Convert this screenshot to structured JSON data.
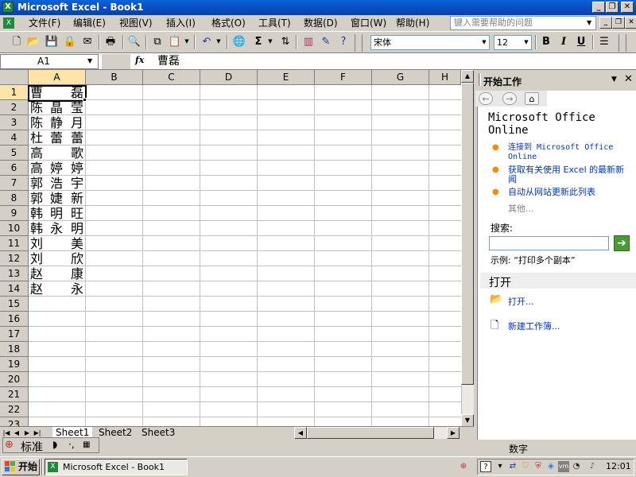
{
  "window": {
    "title": "Microsoft Excel - Book1"
  },
  "menu": [
    "文件(F)",
    "编辑(E)",
    "视图(V)",
    "插入(I)",
    "格式(O)",
    "工具(T)",
    "数据(D)",
    "窗口(W)",
    "帮助(H)"
  ],
  "help_placeholder": "键入需要帮助的问题",
  "toolbar": {
    "font_name": "宋体",
    "font_size": "12",
    "bold": "B",
    "italic": "I",
    "underline": "U",
    "sum": "Σ"
  },
  "formula_bar": {
    "name_box": "A1",
    "fx": "fx",
    "content": "曹磊"
  },
  "columns": [
    "A",
    "B",
    "C",
    "D",
    "E",
    "F",
    "G",
    "H"
  ],
  "rows": [
    "1",
    "2",
    "3",
    "4",
    "5",
    "6",
    "7",
    "8",
    "9",
    "10",
    "11",
    "12",
    "13",
    "14",
    "15",
    "16",
    "17",
    "18",
    "19",
    "20",
    "21",
    "22",
    "23"
  ],
  "cells_a": [
    [
      "曹",
      "",
      "磊"
    ],
    [
      "陈",
      "晶",
      "莹"
    ],
    [
      "陈",
      "静",
      "月"
    ],
    [
      "杜",
      "蕾",
      "蕾"
    ],
    [
      "高",
      "",
      "歌"
    ],
    [
      "高",
      "婷",
      "婷"
    ],
    [
      "郭",
      "浩",
      "宇"
    ],
    [
      "郭",
      "婕",
      "新"
    ],
    [
      "韩",
      "明",
      "旺"
    ],
    [
      "韩",
      "永",
      "明"
    ],
    [
      "刘",
      "",
      "美"
    ],
    [
      "刘",
      "",
      "欣"
    ],
    [
      "赵",
      "",
      "康"
    ],
    [
      "赵",
      "",
      "永"
    ]
  ],
  "sheet_tabs": [
    "Sheet1",
    "Sheet2",
    "Sheet3"
  ],
  "status": {
    "mode": "数字",
    "ime_label": "标准"
  },
  "task_pane": {
    "title": "开始工作",
    "office_online": "Microsoft Office Online",
    "links": [
      "连接到 Microsoft Office Online",
      "获取有关使用 Excel 的最新新闻",
      "自动从网站更新此列表"
    ],
    "more": "其他...",
    "search_label": "搜索:",
    "example": "示例:  “打印多个副本”",
    "open_section": "打开",
    "open_link": "打开...",
    "new_link": "新建工作簿..."
  },
  "taskbar": {
    "start": "开始",
    "task": "Microsoft Excel - Book1",
    "clock": "12:01"
  },
  "colors": {
    "title_bar": "#0a52c8",
    "accent_link": "#0033cc",
    "bullet": "#f28c00",
    "active_header": "#ffe4a8"
  }
}
